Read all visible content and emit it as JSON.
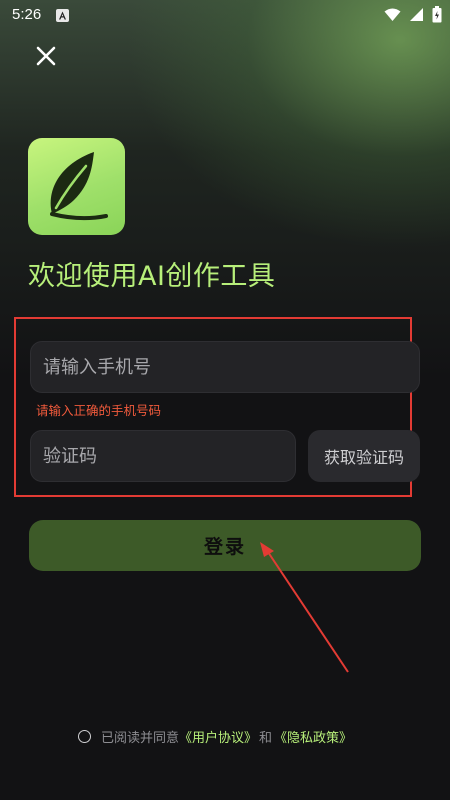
{
  "status_bar": {
    "time": "5:26",
    "icons": [
      "app-notification-icon",
      "wifi-icon",
      "signal-icon",
      "battery-icon"
    ]
  },
  "header": {
    "close_icon": "close-icon"
  },
  "brand": {
    "logo_icon": "leaf-icon",
    "welcome": "欢迎使用AI创作工具",
    "accent_color": "#b7ef7a"
  },
  "form": {
    "phone_placeholder": "请输入手机号",
    "phone_value": "",
    "phone_error": "请输入正确的手机号码",
    "code_placeholder": "验证码",
    "code_value": "",
    "get_code_label": "获取验证码",
    "login_label": "登录",
    "error_color": "#f05a3c",
    "highlight_color": "#e33b34"
  },
  "agreement": {
    "prefix": "已阅读并同意",
    "user_agreement": "《用户协议》",
    "conjunction": "和",
    "privacy_policy": "《隐私政策》"
  }
}
